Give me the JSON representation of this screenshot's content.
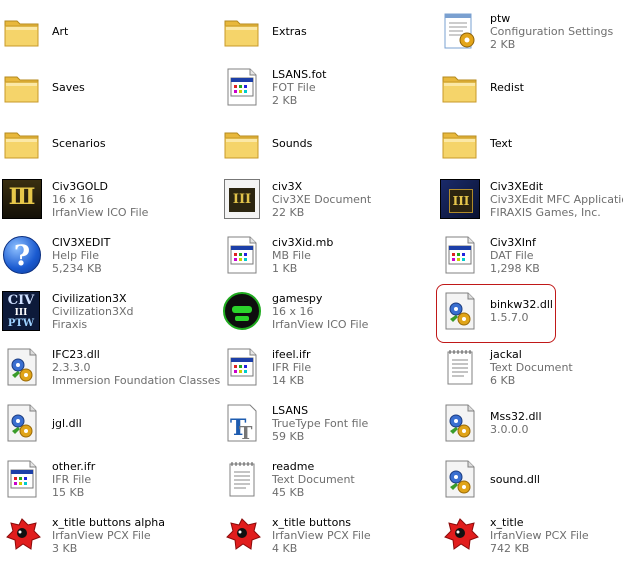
{
  "items": [
    {
      "name": "Art",
      "lines": [],
      "icon": "folder-icon"
    },
    {
      "name": "Extras",
      "lines": [],
      "icon": "folder-icon"
    },
    {
      "name": "ptw",
      "lines": [
        "Configuration Settings",
        "2 KB"
      ],
      "icon": "config-settings-icon"
    },
    {
      "name": "Saves",
      "lines": [],
      "icon": "folder-icon"
    },
    {
      "name": "LSANS.fot",
      "lines": [
        "FOT File",
        "2 KB"
      ],
      "icon": "generic-file-icon"
    },
    {
      "name": "Redist",
      "lines": [],
      "icon": "folder-icon"
    },
    {
      "name": "Scenarios",
      "lines": [],
      "icon": "folder-icon"
    },
    {
      "name": "Sounds",
      "lines": [],
      "icon": "folder-icon"
    },
    {
      "name": "Text",
      "lines": [],
      "icon": "folder-icon"
    },
    {
      "name": "Civ3GOLD",
      "lines": [
        "16 x 16",
        "IrfanView ICO File"
      ],
      "icon": "civ3-gold-icon"
    },
    {
      "name": "civ3X",
      "lines": [
        "Civ3XE Document",
        "22 KB"
      ],
      "icon": "civ3x-document-icon"
    },
    {
      "name": "Civ3XEdit",
      "lines": [
        "Civ3XEdit MFC Application",
        "FIRAXIS Games, Inc."
      ],
      "icon": "civ3x-editor-icon"
    },
    {
      "name": "CIV3XEDIT",
      "lines": [
        "Help File",
        "5,234 KB"
      ],
      "icon": "help-file-icon"
    },
    {
      "name": "civ3Xid.mb",
      "lines": [
        "MB File",
        "1 KB"
      ],
      "icon": "generic-file-icon"
    },
    {
      "name": "Civ3XInf",
      "lines": [
        "DAT File",
        "1,298 KB"
      ],
      "icon": "generic-file-icon"
    },
    {
      "name": "Civilization3X",
      "lines": [
        "Civilization3Xd",
        "Firaxis"
      ],
      "icon": "civ-ptw-icon"
    },
    {
      "name": "gamespy",
      "lines": [
        "16 x 16",
        "IrfanView ICO File"
      ],
      "icon": "gamespy-icon"
    },
    {
      "name": "binkw32.dll",
      "lines": [
        "1.5.7.0"
      ],
      "icon": "dll-gear-icon"
    },
    {
      "name": "IFC23.dll",
      "lines": [
        "2.3.3.0",
        "Immersion Foundation Classes"
      ],
      "icon": "dll-gear-icon"
    },
    {
      "name": "ifeel.ifr",
      "lines": [
        "IFR File",
        "14 KB"
      ],
      "icon": "generic-file-icon"
    },
    {
      "name": "jackal",
      "lines": [
        "Text Document",
        "6 KB"
      ],
      "icon": "text-document-icon"
    },
    {
      "name": "jgl.dll",
      "lines": [],
      "icon": "dll-gear-icon"
    },
    {
      "name": "LSANS",
      "lines": [
        "TrueType Font file",
        "59 KB"
      ],
      "icon": "truetype-font-icon"
    },
    {
      "name": "Mss32.dll",
      "lines": [
        "3.0.0.0"
      ],
      "icon": "dll-gear-icon"
    },
    {
      "name": "other.ifr",
      "lines": [
        "IFR File",
        "15 KB"
      ],
      "icon": "generic-file-icon"
    },
    {
      "name": "readme",
      "lines": [
        "Text Document",
        "45 KB"
      ],
      "icon": "text-document-icon"
    },
    {
      "name": "sound.dll",
      "lines": [],
      "icon": "dll-gear-icon"
    },
    {
      "name": "x_title buttons alpha",
      "lines": [
        "IrfanView PCX File",
        "3 KB"
      ],
      "icon": "irfanview-pcx-icon"
    },
    {
      "name": "x_title buttons",
      "lines": [
        "IrfanView PCX File",
        "4 KB"
      ],
      "icon": "irfanview-pcx-icon"
    },
    {
      "name": "x_title",
      "lines": [
        "IrfanView PCX File",
        "742 KB"
      ],
      "icon": "irfanview-pcx-icon"
    }
  ],
  "selected_item": "binkw32.dll",
  "colors": {
    "selection_ring": "#c01818",
    "meta_text": "#6e6e6e",
    "folder": "#f5d46a"
  }
}
